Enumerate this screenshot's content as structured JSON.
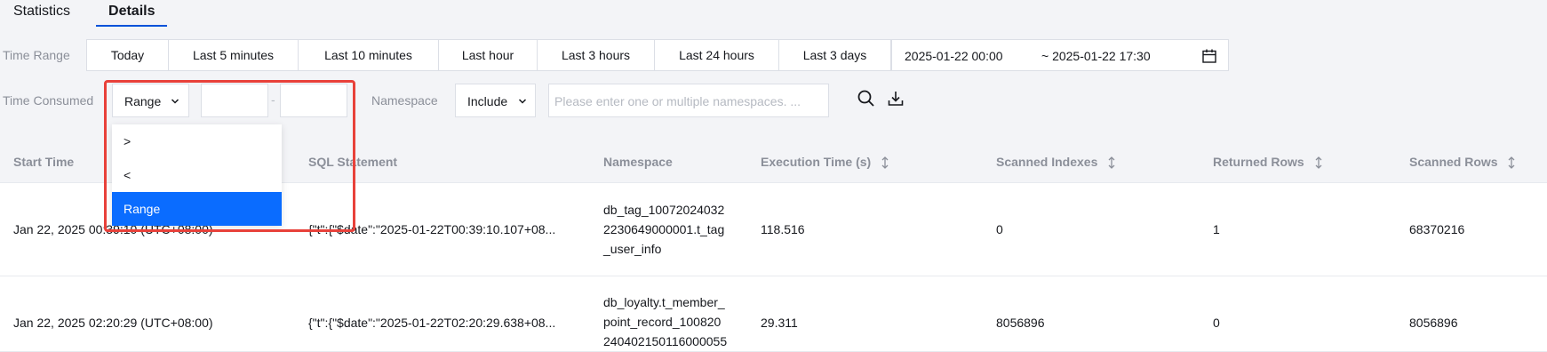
{
  "tabs": [
    {
      "label": "Statistics"
    },
    {
      "label": "Details"
    }
  ],
  "filters": {
    "time_range_label": "Time Range",
    "time_presets": [
      "Today",
      "Last 5 minutes",
      "Last 10 minutes",
      "Last hour",
      "Last 3 hours",
      "Last 24 hours",
      "Last 3 days"
    ],
    "date_from": "2025-01-22 00:00",
    "date_to": "~ 2025-01-22 17:30",
    "time_consumed_label": "Time Consumed",
    "consumed_mode": "Range",
    "range_separator": "-",
    "namespace_label": "Namespace",
    "namespace_mode": "Include",
    "namespace_placeholder": "Please enter one or multiple namespaces. ..."
  },
  "dropdown": {
    "options": [
      ">",
      "<",
      "Range"
    ],
    "selected": "Range"
  },
  "table": {
    "headers": [
      "Start Time",
      "SQL Statement",
      "Namespace",
      "Execution Time (s)",
      "Scanned Indexes",
      "Returned Rows",
      "Scanned Rows"
    ],
    "rows": [
      {
        "start_time": "Jan 22, 2025 00:39:10 (UTC+08:00)",
        "sql": "{\"t\":{\"$date\":\"2025-01-22T00:39:10.107+08...",
        "namespace": [
          "db_tag_10072024032",
          "2230649000001.t_tag",
          "_user_info"
        ],
        "exec_time": "118.516",
        "scanned_indexes": "0",
        "returned_rows": "1",
        "scanned_rows": "68370216"
      },
      {
        "start_time": "Jan 22, 2025 02:20:29 (UTC+08:00)",
        "sql": "{\"t\":{\"$date\":\"2025-01-22T02:20:29.638+08...",
        "namespace": [
          "db_loyalty.t_member_",
          "point_record_100820",
          "240402150116000055"
        ],
        "exec_time": "29.311",
        "scanned_indexes": "8056896",
        "returned_rows": "0",
        "scanned_rows": "8056896"
      }
    ]
  },
  "colors": {
    "accent": "#0052d9",
    "selected_option": "#0a6cff",
    "highlight_border": "#e8413a"
  }
}
